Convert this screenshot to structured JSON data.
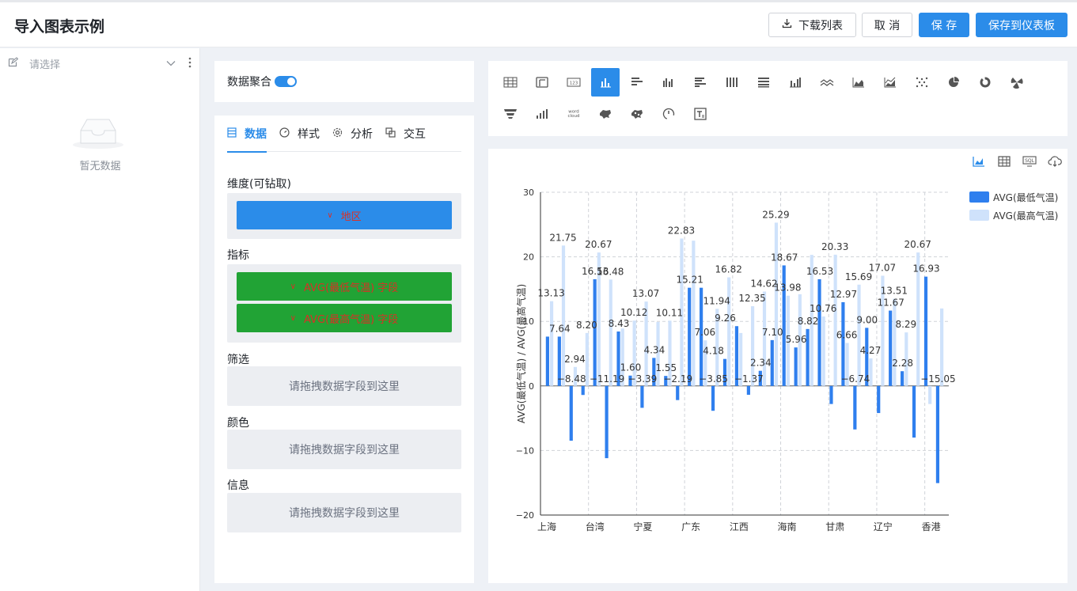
{
  "header": {
    "title": "导入图表示例",
    "download_label": "下载列表",
    "cancel_label": "取 消",
    "save_label": "保 存",
    "save_dashboard_label": "保存到仪表板"
  },
  "left_panel": {
    "select_placeholder": "请选择",
    "empty_text": "暂无数据"
  },
  "aggregation": {
    "label": "数据聚合",
    "enabled": true
  },
  "config_tabs": [
    {
      "label": "数据",
      "icon": "data-icon",
      "active": true
    },
    {
      "label": "样式",
      "icon": "style-icon",
      "active": false
    },
    {
      "label": "分析",
      "icon": "gear-icon",
      "active": false
    },
    {
      "label": "交互",
      "icon": "interaction-icon",
      "active": false
    }
  ],
  "dimension": {
    "label": "维度(可钻取)",
    "field": "地区"
  },
  "metrics": {
    "label": "指标",
    "fields": [
      "AVG(最低气温) 字段",
      "AVG(最高气温) 字段"
    ]
  },
  "filter": {
    "label": "筛选",
    "placeholder": "请拖拽数据字段到这里"
  },
  "color": {
    "label": "颜色",
    "placeholder": "请拖拽数据字段到这里"
  },
  "info": {
    "label": "信息",
    "placeholder": "请拖拽数据字段到这里"
  },
  "chart_types": [
    "table-icon",
    "pivot-table-icon",
    "number-card-icon",
    "column-chart-icon",
    "bar-chart-icon",
    "grouped-column-icon",
    "grouped-bar-icon",
    "stacked-column-icon",
    "stacked-bar-icon",
    "combo-chart-icon",
    "line-chart-icon",
    "area-chart-icon",
    "stacked-area-icon",
    "scatter-chart-icon",
    "pie-chart-icon",
    "donut-chart-icon",
    "rose-chart-icon",
    "funnel-chart-icon",
    "waterfall-chart-icon",
    "word-cloud-icon",
    "china-map-icon",
    "scatter-map-icon",
    "gauge-icon",
    "rich-text-icon"
  ],
  "active_chart_type": "column-chart-icon",
  "word_cloud_text": "word cloud",
  "colors": {
    "accent": "#2b8ce9",
    "series1": "#2f7fee",
    "series2": "#cfe2fb",
    "green": "#21a335"
  },
  "chart_data": {
    "type": "bar",
    "ylabel": "AVG(最低气温) / AVG(最高气温)",
    "ylim": [
      -20,
      30
    ],
    "yticks": [
      -20,
      -10,
      0,
      10,
      20,
      30
    ],
    "xtick_labels": [
      "上海",
      "台湾",
      "宁夏",
      "广东",
      "江西",
      "海南",
      "甘肃",
      "辽宁",
      "香港"
    ],
    "legend_position": "top-right",
    "series": [
      {
        "name": "AVG(最低气温)",
        "values": [
          7.64,
          7.64,
          -8.48,
          -1.4,
          16.53,
          -11.19,
          8.43,
          1.6,
          -3.39,
          4.34,
          1.55,
          -2.19,
          15.21,
          15.21,
          -3.85,
          4.18,
          9.26,
          -1.37,
          2.34,
          7.1,
          18.67,
          5.96,
          8.82,
          16.53,
          -2.8,
          12.97,
          -6.74,
          9.0,
          -4.2,
          11.67,
          2.28,
          -8.0,
          16.93,
          -15.05
        ]
      },
      {
        "name": "AVG(最高气温)",
        "values": [
          13.13,
          21.75,
          2.94,
          8.2,
          20.67,
          16.48,
          8.9,
          10.12,
          13.07,
          9.9,
          10.11,
          22.83,
          22.5,
          7.06,
          11.94,
          16.82,
          8.2,
          12.35,
          14.62,
          25.29,
          13.98,
          14.2,
          20.3,
          10.76,
          20.33,
          6.66,
          15.69,
          4.27,
          17.07,
          13.51,
          8.29,
          20.67,
          -2.8,
          12.0
        ]
      }
    ],
    "labels": [
      {
        "text": "13.13"
      },
      {
        "text": "21.75"
      },
      {
        "text": "7.64"
      },
      {
        "text": "2.94"
      },
      {
        "text": "−8.48"
      },
      {
        "text": "20.67"
      },
      {
        "text": "8.20"
      },
      {
        "text": "16.53"
      },
      {
        "text": "−11.19"
      },
      {
        "text": "16.48"
      },
      {
        "text": "8.43"
      },
      {
        "text": "1.60"
      },
      {
        "text": "−3.39"
      },
      {
        "text": "13.07"
      },
      {
        "text": "10.12"
      },
      {
        "text": "4.34"
      },
      {
        "text": "1.55"
      },
      {
        "text": "−2.19"
      },
      {
        "text": "22.83"
      },
      {
        "text": "10.11"
      },
      {
        "text": "15.21"
      },
      {
        "text": "7.06"
      },
      {
        "text": "−3.85"
      },
      {
        "text": "16.82"
      },
      {
        "text": "11.94"
      },
      {
        "text": "9.26"
      },
      {
        "text": "4.18"
      },
      {
        "text": "−1.37"
      },
      {
        "text": "12.35"
      },
      {
        "text": "2.34"
      },
      {
        "text": "7.10"
      },
      {
        "text": "25.29"
      },
      {
        "text": "18.67"
      },
      {
        "text": "14.62"
      },
      {
        "text": "13.98"
      },
      {
        "text": "5.96"
      },
      {
        "text": "8.82"
      },
      {
        "text": "16.53"
      },
      {
        "text": "20.33"
      },
      {
        "text": "10.76"
      },
      {
        "text": "12.97"
      },
      {
        "text": "−6.74"
      },
      {
        "text": "6.66"
      },
      {
        "text": "15.69"
      },
      {
        "text": "9.00"
      },
      {
        "text": "17.07"
      },
      {
        "text": "11.67"
      },
      {
        "text": "4.27"
      },
      {
        "text": "13.51"
      },
      {
        "text": "2.28"
      },
      {
        "text": "8.29"
      },
      {
        "text": "20.67"
      },
      {
        "text": "16.93"
      },
      {
        "text": "−15.05"
      }
    ]
  }
}
